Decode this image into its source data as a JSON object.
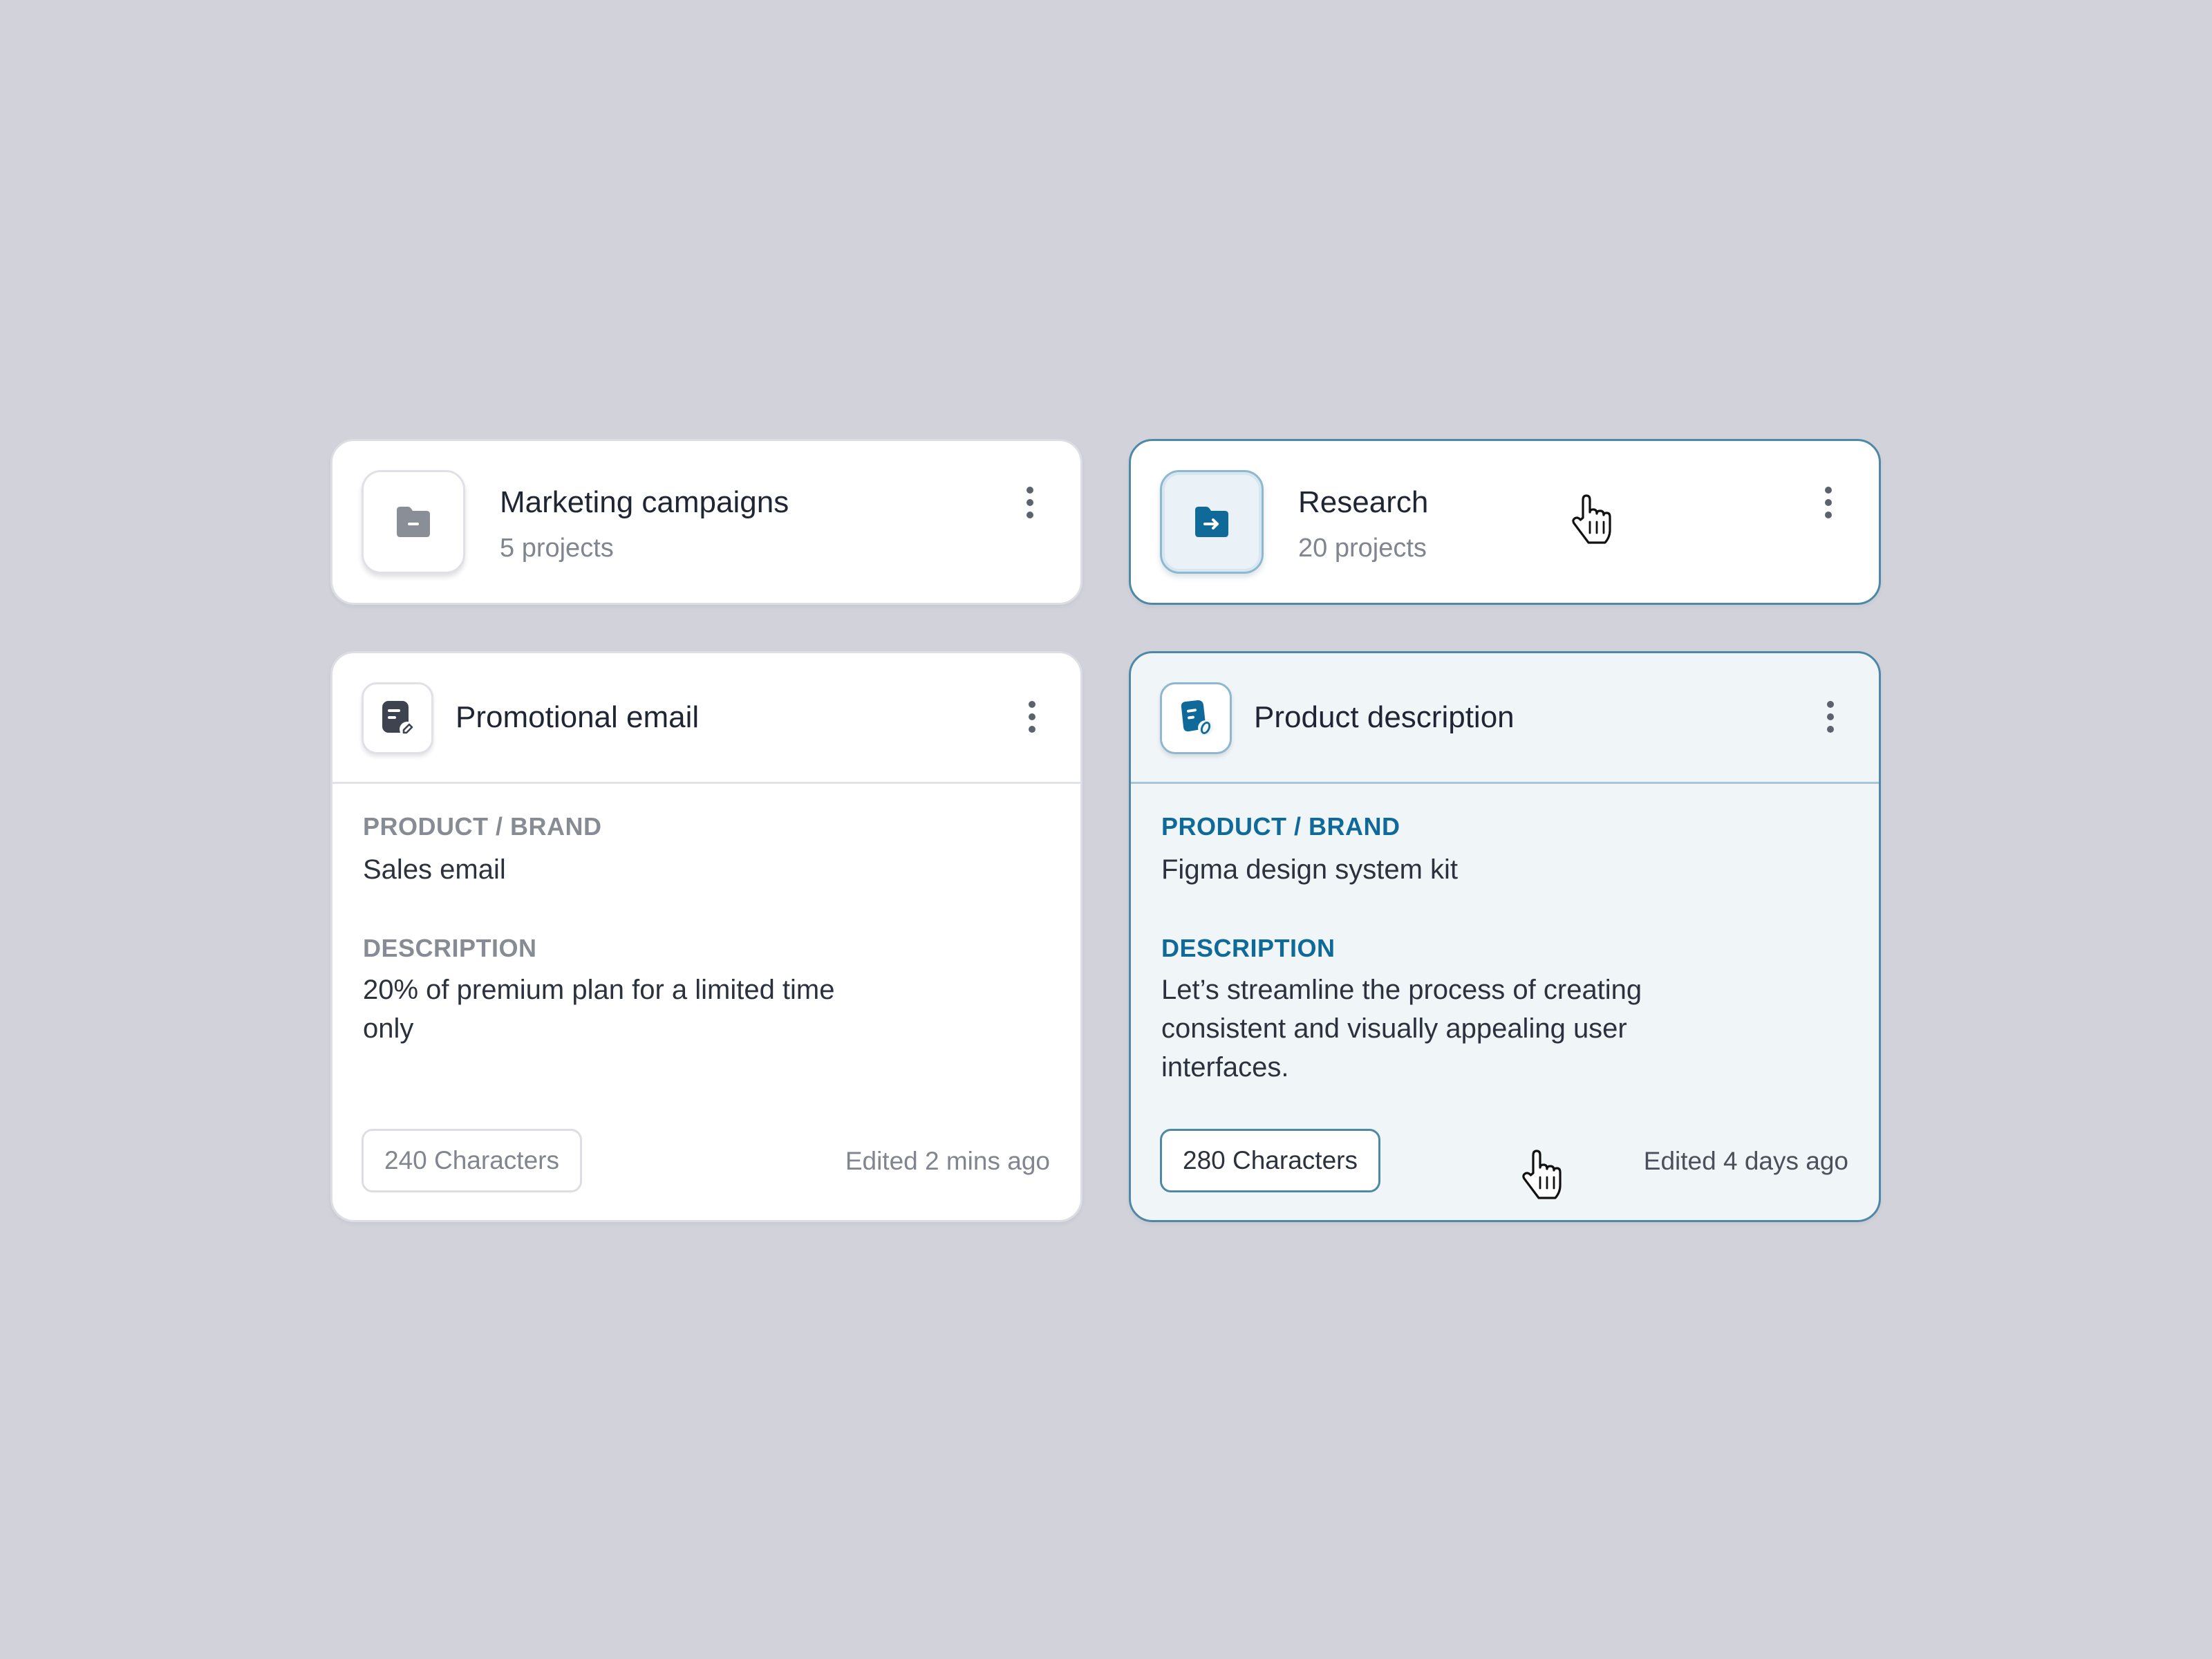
{
  "colors": {
    "page_background": "#d1d2da",
    "card_background": "#ffffff",
    "active_accent": "#0f6a99",
    "active_border": "#4f88a6",
    "active_tint": "#f0f5f8",
    "muted_text": "#80858f"
  },
  "folders": [
    {
      "title": "Marketing campaigns",
      "subtitle": "5 projects",
      "icon": "folder-minus-icon",
      "state": "default"
    },
    {
      "title": "Research",
      "subtitle": "20 projects",
      "icon": "folder-arrow-icon",
      "state": "hover"
    }
  ],
  "documents": [
    {
      "title": "Promotional email",
      "icon": "document-edit-icon",
      "product_label": "PRODUCT / BRAND",
      "product_value": "Sales email",
      "description_label": "DESCRIPTION",
      "description_value": "20% of premium plan for a limited time only",
      "characters": "240 Characters",
      "edited": "Edited 2 mins ago",
      "state": "default"
    },
    {
      "title": "Product description",
      "icon": "tag-document-icon",
      "product_label": "PRODUCT / BRAND",
      "product_value": "Figma design system kit",
      "description_label": "DESCRIPTION",
      "description_value": "Let’s streamline the process of creating consistent and visually appealing user interfaces.",
      "characters": "280 Characters",
      "edited": "Edited 4 days ago",
      "state": "hover"
    }
  ],
  "menu_icon": "more-vertical-icon",
  "pointer_icon": "hand-pointer-icon"
}
